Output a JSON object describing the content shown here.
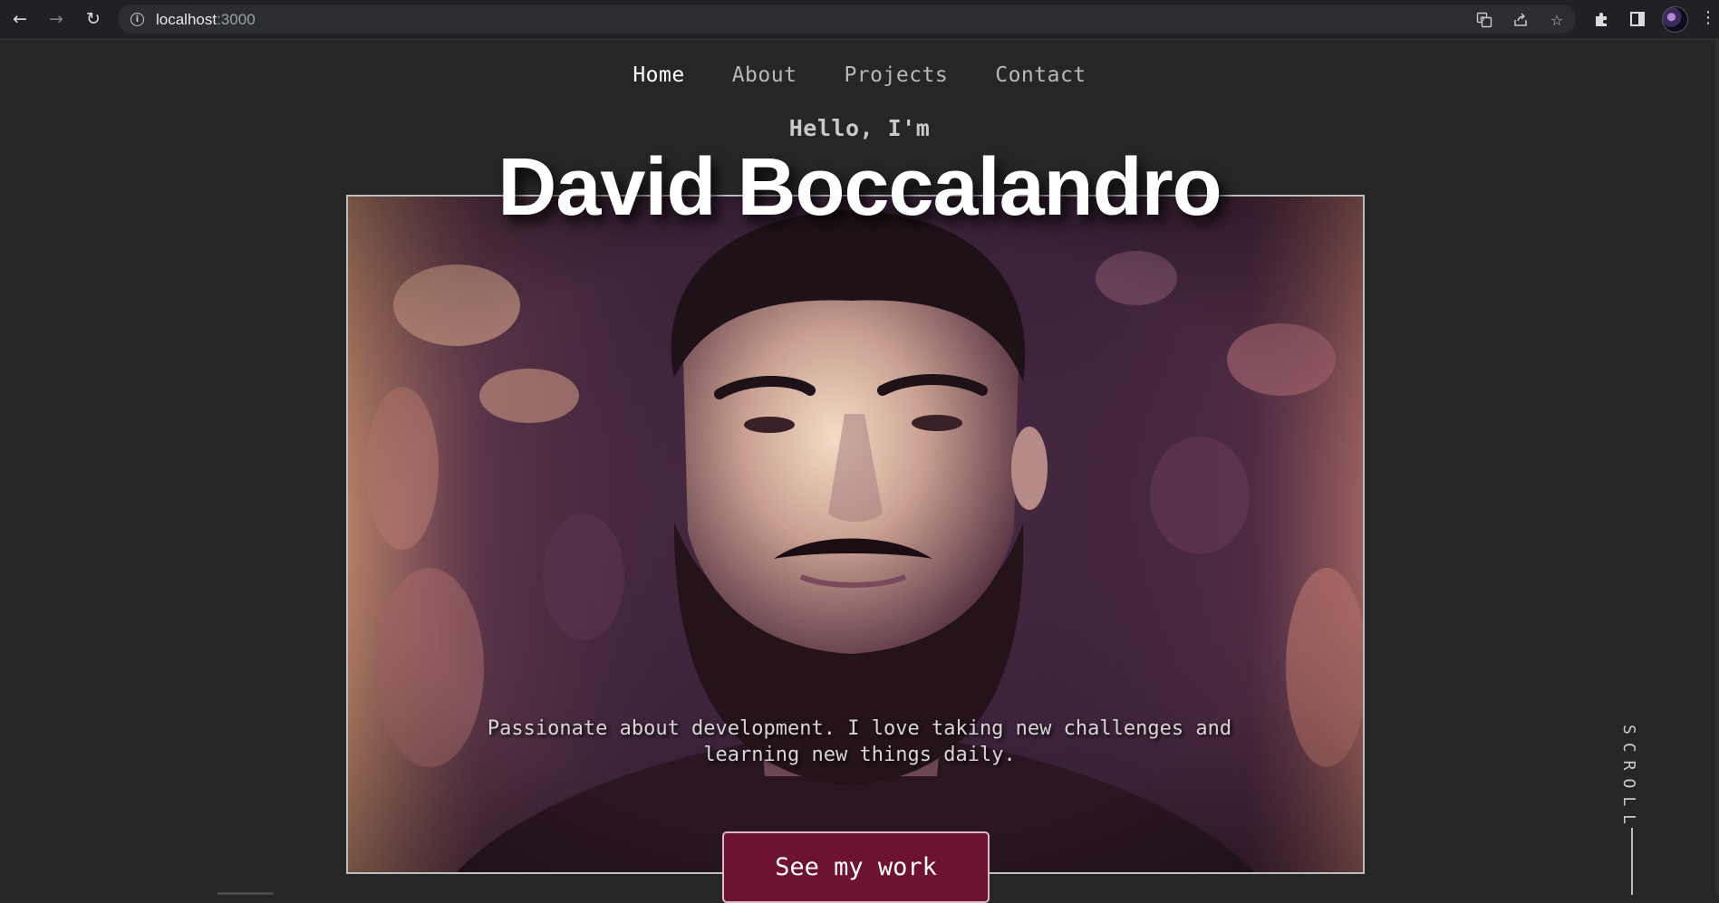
{
  "browser": {
    "url_host": "localhost",
    "url_port": ":3000",
    "icons": {
      "back": "arrow-left-icon",
      "forward": "arrow-right-icon",
      "reload": "reload-icon",
      "site_info": "info-icon",
      "translate": "translate-icon",
      "share": "share-icon",
      "bookmark": "star-icon",
      "extensions": "puzzle-icon",
      "side_panel": "side-panel-icon",
      "menu": "kebab-menu-icon"
    }
  },
  "nav": {
    "items": [
      {
        "label": "Home",
        "active": true
      },
      {
        "label": "About",
        "active": false
      },
      {
        "label": "Projects",
        "active": false
      },
      {
        "label": "Contact",
        "active": false
      }
    ]
  },
  "hero": {
    "greeting": "Hello, I'm",
    "name": "David Boccalandro",
    "tagline_line1": "Passionate about development. I love taking new challenges and",
    "tagline_line2": "learning new things daily.",
    "cta_label": "See my work",
    "scroll_label": "SCROLL"
  },
  "colors": {
    "background": "#262626",
    "cta_background": "#6e1234",
    "cta_border": "#d9b7c4",
    "nav_active": "#ffffff",
    "nav_inactive": "#b8b8b8"
  }
}
